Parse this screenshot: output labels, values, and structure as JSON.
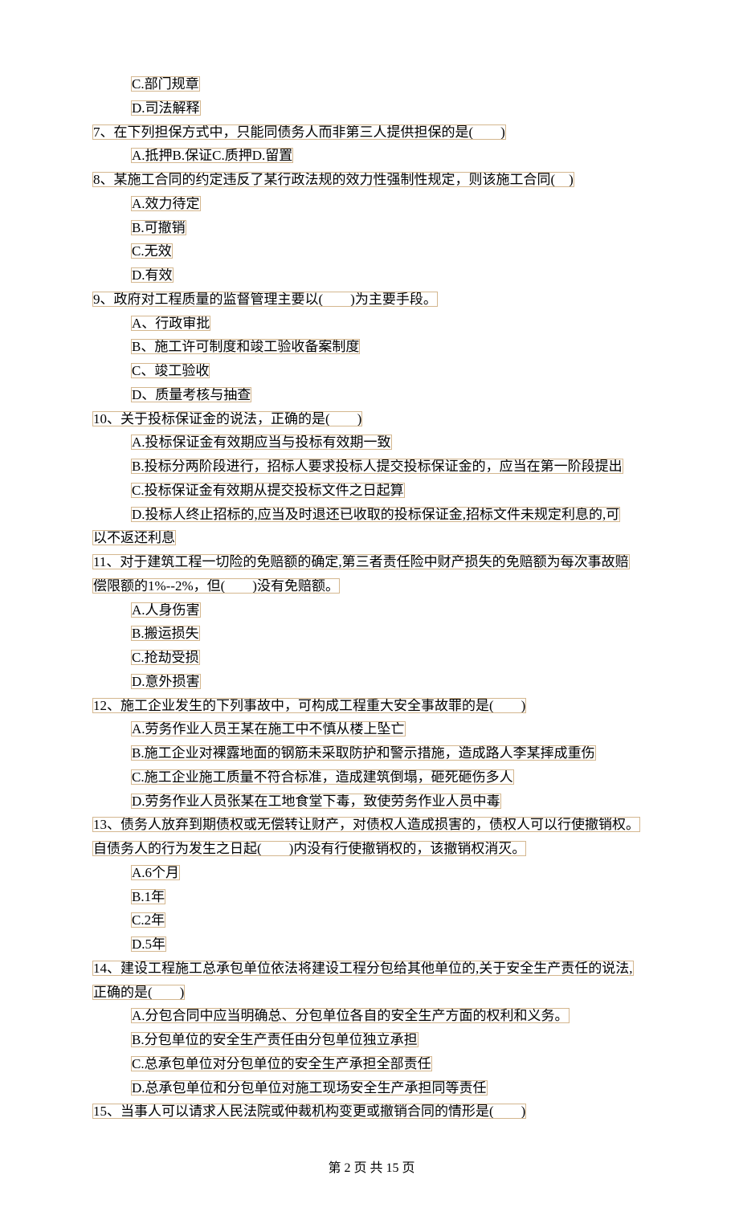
{
  "preOptions": {
    "c": "C.部门规章",
    "d": "D.司法解释"
  },
  "q7": {
    "stem": "7、在下列担保方式中，只能同债务人而非第三人提供担保的是(　　)",
    "opts": "A.抵押B.保证C.质押D.留置"
  },
  "q8": {
    "stem": "8、某施工合同的约定违反了某行政法规的效力性强制性规定，则该施工合同(　)",
    "a": "A.效力待定",
    "b": "B.可撤销",
    "c": "C.无效",
    "d": "D.有效"
  },
  "q9": {
    "stem": "9、政府对工程质量的监督管理主要以(　　)为主要手段。",
    "a": "A、行政审批",
    "b": "B、施工许可制度和竣工验收备案制度",
    "c": "C、竣工验收",
    "d": "D、质量考核与抽查"
  },
  "q10": {
    "stem": "10、关于投标保证金的说法，正确的是(　　)",
    "a": "A.投标保证金有效期应当与投标有效期一致",
    "b": "B.投标分两阶段进行，招标人要求投标人提交投标保证金的，应当在第一阶段提出",
    "c": "C.投标保证金有效期从提交投标文件之日起算",
    "d1": "D.投标人终止招标的,应当及时退还已收取的投标保证金,招标文件未规定利息的,可",
    "d2": "以不返还利息"
  },
  "q11": {
    "stem1": "11、对于建筑工程一切险的免赔额的确定,第三者责任险中财产损失的免赔额为每次事故赔",
    "stem2": "偿限额的1%--2%，但(　　)没有免赔额。",
    "a": "A.人身伤害",
    "b": "B.搬运损失",
    "c": "C.抢劫受损",
    "d": "D.意外损害"
  },
  "q12": {
    "stem": "12、施工企业发生的下列事故中，可构成工程重大安全事故罪的是(　　)",
    "a": "A.劳务作业人员王某在施工中不慎从楼上坠亡",
    "b": "B.施工企业对裸露地面的钢筋未采取防护和警示措施，造成路人李某摔成重伤",
    "c": "C.施工企业施工质量不符合标准，造成建筑倒塌，砸死砸伤多人",
    "d": "D.劳务作业人员张某在工地食堂下毒，致使劳务作业人员中毒"
  },
  "q13": {
    "stem1": "13、债务人放弃到期债权或无偿转让财产，对债权人造成损害的，债权人可以行使撤销权。",
    "stem2": "自债务人的行为发生之日起(　　)内没有行使撤销权的，该撤销权消灭。",
    "a": "A.6个月",
    "b": "B.1年",
    "c": "C.2年",
    "d": "D.5年"
  },
  "q14": {
    "stem1": "14、建设工程施工总承包单位依法将建设工程分包给其他单位的,关于安全生产责任的说法,",
    "stem2": "正确的是(　　)",
    "a": "A.分包合同中应当明确总、分包单位各自的安全生产方面的权利和义务。",
    "b": "B.分包单位的安全生产责任由分包单位独立承担",
    "c": "C.总承包单位对分包单位的安全生产承担全部责任",
    "d": "D.总承包单位和分包单位对施工现场安全生产承担同等责任"
  },
  "q15": {
    "stem": "15、当事人可以请求人民法院或仲裁机构变更或撤销合同的情形是(　　)"
  },
  "footer": "第 2 页 共 15 页"
}
